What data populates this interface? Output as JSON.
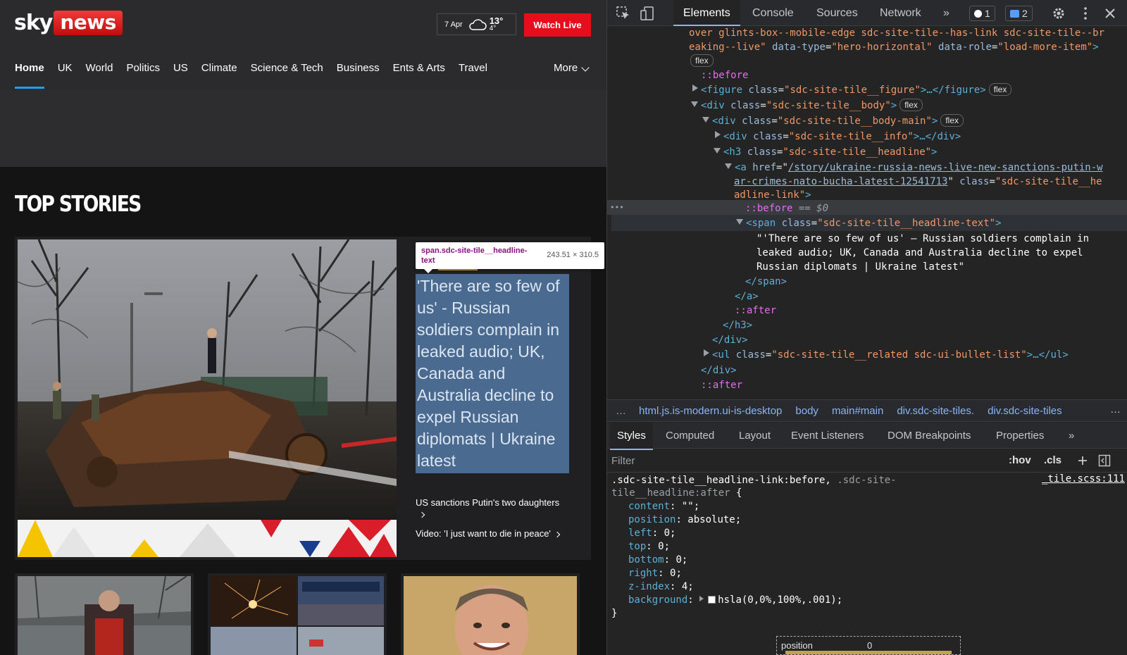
{
  "site": {
    "logo": {
      "sky": "sky",
      "news": "news"
    },
    "weather": {
      "date": "7 Apr",
      "icon": "cloud-icon",
      "high": "13°",
      "low": "4°"
    },
    "watch_live": "Watch Live",
    "nav": [
      {
        "label": "Home",
        "active": true
      },
      {
        "label": "UK"
      },
      {
        "label": "World"
      },
      {
        "label": "Politics"
      },
      {
        "label": "US"
      },
      {
        "label": "Climate"
      },
      {
        "label": "Science & Tech"
      },
      {
        "label": "Business"
      },
      {
        "label": "Ents & Arts"
      },
      {
        "label": "Travel"
      }
    ],
    "nav_more": "More",
    "section_title": "TOP STORIES",
    "hero": {
      "headline": "'There are so few of us' - Russian soldiers complain in leaked audio; UK, Canada and Australia decline to expel Russian diplomats | Ukraine latest",
      "related": [
        "US sanctions Putin's two daughters",
        "Video: 'I just want to die in peace'"
      ]
    },
    "tooltip": {
      "element": "span.sdc-site-tile__headline-text",
      "size": "243.51 × 310.5"
    },
    "accent_color": "#e60e1c"
  },
  "devtools": {
    "tabs": [
      "Elements",
      "Console",
      "Sources",
      "Network"
    ],
    "more_tabs": "»",
    "error_count": "1",
    "message_count": "2",
    "dom": {
      "l1": "over glints-box--mobile-edge sdc-site-tile--has-link sdc-site-tile--br",
      "l2": "eaking--live\"",
      "l2_attr1": "data-type",
      "l2_val1": "\"hero-horizontal\"",
      "l2_attr2": "data-role",
      "l2_val2": "\"load-more-item\"",
      "flex": "flex",
      "before": "::before",
      "after": "::after",
      "figure_open": "<figure",
      "class_attr": "class",
      "figure_val": "\"sdc-site-tile__figure\"",
      "figure_close": ">…</figure>",
      "body_open": "<div",
      "body_val": "\"sdc-site-tile__body\"",
      "body_main_val": "\"sdc-site-tile__body-main\"",
      "info_val": "\"sdc-site-tile__info\"",
      "div_close_ell": ">…</div>",
      "h3_open": "<h3",
      "h3_val": "\"sdc-site-tile__headline\"",
      "a_open": "<a",
      "href_attr": "href",
      "href_1": "/story/ukraine-russia-news-live-new-sanctions-putin-w",
      "href_2": "ar-crimes-nato-bucha-latest-12541713",
      "a_class_1": "\"sdc-site-tile__he",
      "a_class_2": "adline-link\"",
      "selected_pseudo": "::before",
      "selected_suffix": "== $0",
      "ellipsis": "•••",
      "span_open": "<span",
      "span_val": "\"sdc-site-tile__headline-text\"",
      "text_1": "\"'There are so few of us' – Russian soldiers complain in",
      "text_2": "leaked audio; UK, Canada and Australia decline to expel",
      "text_3": "Russian diplomats | Ukraine latest\"",
      "span_close": "</span>",
      "a_close": "</a>",
      "h3_close": "</h3>",
      "div_close": "</div>",
      "ul_open": "<ul",
      "ul_val": "\"sdc-site-tile__related sdc-ui-bullet-list\"",
      "ul_close": ">…</ul>"
    },
    "breadcrumbs": [
      "html.js.is-modern.ui-is-desktop",
      "body",
      "main#main",
      "div.sdc-site-tiles.",
      "div.sdc-site-tiles"
    ],
    "crumb_more": "…",
    "styles_tabs": [
      "Styles",
      "Computed",
      "Layout",
      "Event Listeners",
      "DOM Breakpoints",
      "Properties"
    ],
    "filter_placeholder": "Filter",
    "hov": ":hov",
    "cls": ".cls",
    "rule": {
      "selector_1": ".sdc-site-tile__headline-link:before,",
      "selector_2": ".sdc-site-",
      "selector_3": "tile__headline:after",
      "open": "{",
      "source": "_tile.scss:111",
      "props": [
        {
          "name": "content",
          "value": "\"\";"
        },
        {
          "name": "position",
          "value": "absolute;"
        },
        {
          "name": "left",
          "value": "0;"
        },
        {
          "name": "top",
          "value": "0;"
        },
        {
          "name": "bottom",
          "value": "0;"
        },
        {
          "name": "right",
          "value": "0;"
        },
        {
          "name": "z-index",
          "value": "4;"
        },
        {
          "name": "background",
          "value": "hsla(0,0%,100%,.001);"
        }
      ],
      "close": "}"
    },
    "box_model": {
      "label": "position",
      "value": "0"
    }
  }
}
